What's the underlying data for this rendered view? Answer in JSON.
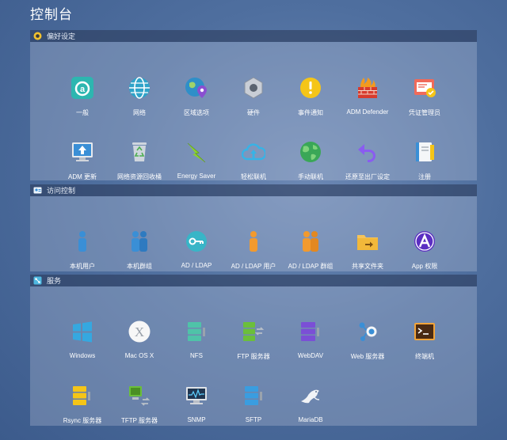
{
  "window": {
    "title": "控制台"
  },
  "sections": [
    {
      "title": "偏好设定",
      "items": [
        {
          "label": "一般",
          "icon": "general-icon"
        },
        {
          "label": "网络",
          "icon": "network-globe-icon"
        },
        {
          "label": "区域选项",
          "icon": "region-globe-pin-icon"
        },
        {
          "label": "硬件",
          "icon": "hardware-nut-icon"
        },
        {
          "label": "事件通知",
          "icon": "notification-icon"
        },
        {
          "label": "ADM Defender",
          "icon": "firewall-icon"
        },
        {
          "label": "凭证管理员",
          "icon": "certificate-icon"
        },
        {
          "label": "ADM 更新",
          "icon": "update-monitor-icon"
        },
        {
          "label": "网络资源回收桶",
          "icon": "recycle-bin-icon"
        },
        {
          "label": "Energy Saver",
          "icon": "lightning-icon"
        },
        {
          "label": "轻松联机",
          "icon": "cloud-upload-icon"
        },
        {
          "label": "手动联机",
          "icon": "manual-connect-globe-icon"
        },
        {
          "label": "还原至出厂设定",
          "icon": "undo-arrow-icon"
        },
        {
          "label": "注册",
          "icon": "register-book-icon"
        }
      ]
    },
    {
      "title": "访问控制",
      "items": [
        {
          "label": "本机用户",
          "icon": "local-user-icon"
        },
        {
          "label": "本机群组",
          "icon": "local-group-icon"
        },
        {
          "label": "AD / LDAP",
          "icon": "key-icon"
        },
        {
          "label": "AD / LDAP 用户",
          "icon": "ldap-user-icon"
        },
        {
          "label": "AD / LDAP 群组",
          "icon": "ldap-group-icon"
        },
        {
          "label": "共享文件夹",
          "icon": "shared-folder-icon"
        },
        {
          "label": "App 权限",
          "icon": "app-permission-icon"
        }
      ]
    },
    {
      "title": "服务",
      "items": [
        {
          "label": "Windows",
          "icon": "windows-logo-icon"
        },
        {
          "label": "Mac OS X",
          "icon": "mac-os-x-icon"
        },
        {
          "label": "NFS",
          "icon": "nfs-server-icon"
        },
        {
          "label": "FTP 服务器",
          "icon": "ftp-server-icon"
        },
        {
          "label": "WebDAV",
          "icon": "webdav-server-icon"
        },
        {
          "label": "Web 服务器",
          "icon": "web-server-icon"
        },
        {
          "label": "终端机",
          "icon": "terminal-icon"
        },
        {
          "label": "Rsync 服务器",
          "icon": "rsync-server-icon"
        },
        {
          "label": "TFTP 服务器",
          "icon": "tftp-server-icon"
        },
        {
          "label": "SNMP",
          "icon": "snmp-monitor-icon"
        },
        {
          "label": "SFTP",
          "icon": "sftp-server-icon"
        },
        {
          "label": "MariaDB",
          "icon": "mariadb-seal-icon"
        }
      ]
    }
  ]
}
